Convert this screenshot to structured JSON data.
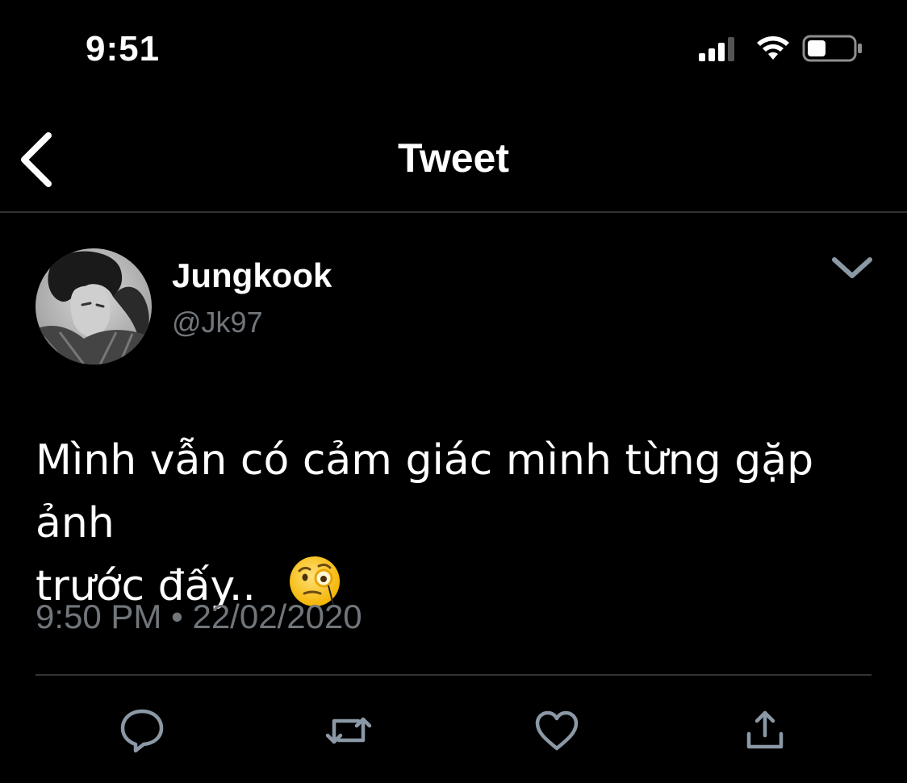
{
  "status_bar": {
    "time": "9:51",
    "icons": [
      "cellular-signal-icon",
      "wifi-icon",
      "battery-icon"
    ]
  },
  "nav": {
    "title": "Tweet",
    "back_icon": "chevron-left-icon"
  },
  "tweet": {
    "author_name": "Jungkook",
    "author_handle": "@Jk97",
    "text_line1": "Mình vẫn có cảm giác mình từng gặp ảnh",
    "text_line2": "trước đấy..",
    "emoji": "face-with-monocle",
    "timestamp": "9:50 PM • 22/02/2020"
  },
  "actions": [
    "reply-icon",
    "retweet-icon",
    "like-icon",
    "share-icon"
  ],
  "colors": {
    "background": "#000000",
    "primary_text": "#ffffff",
    "secondary_text": "#71767b",
    "divider": "#2f3336",
    "icon": "#8b98a5"
  }
}
